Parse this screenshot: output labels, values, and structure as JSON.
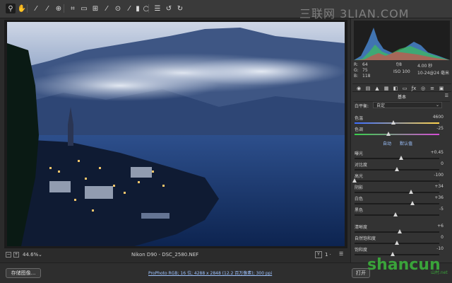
{
  "toolbar": {
    "tools": [
      {
        "icon": "zoom-icon",
        "glyph": "⚲"
      },
      {
        "icon": "hand-icon",
        "glyph": "✋"
      },
      {
        "icon": "white-balance-icon",
        "glyph": "⁄"
      },
      {
        "icon": "color-sampler-icon",
        "glyph": "⁄"
      },
      {
        "icon": "target-adjust-icon",
        "glyph": "⊕"
      },
      {
        "icon": "crop-icon",
        "glyph": "⌗"
      },
      {
        "icon": "straighten-icon",
        "glyph": "▭"
      },
      {
        "icon": "transform-icon",
        "glyph": "⊞"
      },
      {
        "icon": "spot-removal-icon",
        "glyph": "⁄"
      },
      {
        "icon": "red-eye-icon",
        "glyph": "⊙"
      },
      {
        "icon": "adjustment-brush-icon",
        "glyph": "⁄"
      },
      {
        "icon": "graduated-filter-icon",
        "glyph": "▮"
      },
      {
        "icon": "radial-filter-icon",
        "glyph": "○"
      },
      {
        "icon": "preferences-icon",
        "glyph": "☰"
      },
      {
        "icon": "rotate-left-icon",
        "glyph": "↺"
      },
      {
        "icon": "rotate-right-icon",
        "glyph": "↻"
      }
    ]
  },
  "watermark": {
    "text": "三联网 3LIAN.COM"
  },
  "readout": {
    "r_label": "R:",
    "r_value": "64",
    "g_label": "G:",
    "g_value": "75",
    "b_label": "B:",
    "b_value": "118",
    "aperture": "f/8",
    "shutter": "4.00 秒",
    "iso": "ISO 100",
    "lens": "10-24@24 毫米"
  },
  "panel": {
    "title": "基本",
    "menu": "☰",
    "tabs": [
      "basic-tab-icon",
      "tone-curve-tab-icon",
      "detail-tab-icon",
      "hsl-tab-icon",
      "split-toning-tab-icon",
      "lens-tab-icon",
      "effects-tab-icon",
      "camera-calibration-tab-icon",
      "presets-tab-icon",
      "snapshots-tab-icon"
    ],
    "white_balance_label": "白平衡:",
    "white_balance_value": "自定",
    "auto_label": "自动",
    "default_label": "默认值"
  },
  "sliders": [
    {
      "label": "色温",
      "value": "4600",
      "level": 0.46
    },
    {
      "label": "色调",
      "value": "-25",
      "level": 0.4
    },
    {
      "label": "曝光",
      "value": "+0.45",
      "level": 0.55
    },
    {
      "label": "对比度",
      "value": "0",
      "level": 0.5
    },
    {
      "label": "高光",
      "value": "-100",
      "level": 0.0
    },
    {
      "label": "阴影",
      "value": "+34",
      "level": 0.67
    },
    {
      "label": "白色",
      "value": "+36",
      "level": 0.68
    },
    {
      "label": "黑色",
      "value": "-5",
      "level": 0.48
    },
    {
      "label": "清晰度",
      "value": "+6",
      "level": 0.53
    },
    {
      "label": "自然饱和度",
      "value": "0",
      "level": 0.5
    },
    {
      "label": "饱和度",
      "value": "-10",
      "level": 0.45
    }
  ],
  "status": {
    "zoom": "44.6%",
    "filename": "Nikon D90 - DSC_2580.NEF",
    "y_button": "Y",
    "compare": "1 ·"
  },
  "bottom": {
    "save_label": "存储图像...",
    "workflow": "ProPhoto RGB; 16 位; 4288 x 2848 (12.2 百万像素); 300 ppi",
    "open_label": "打开"
  },
  "site_watermark": {
    "text": "shancun",
    "sub": "山村.net"
  }
}
